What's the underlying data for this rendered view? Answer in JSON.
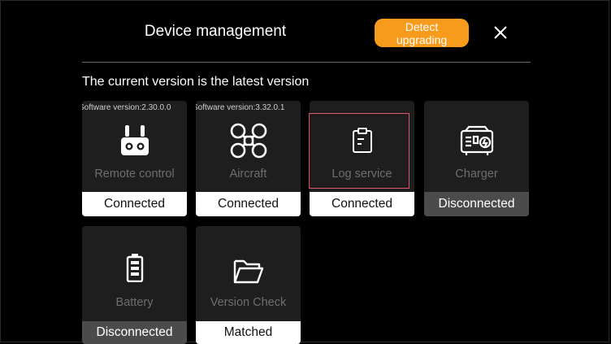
{
  "header": {
    "title": "Device management",
    "detect_label": "Detect upgrading",
    "close_icon": "close-icon"
  },
  "status_text": "The current version is the latest version",
  "devices": [
    {
      "key": "remote",
      "version": "Software version:2.30.0.0",
      "name": "Remote control",
      "state": "Connected",
      "icon": "remote-controller-icon"
    },
    {
      "key": "aircraft",
      "version": "Software version:3.32.0.1",
      "name": "Aircraft",
      "state": "Connected",
      "icon": "drone-icon"
    },
    {
      "key": "log",
      "version": "",
      "name": "Log service",
      "state": "Connected",
      "icon": "clipboard-icon"
    },
    {
      "key": "charger",
      "version": "",
      "name": "Charger",
      "state": "Disconnected",
      "icon": "charger-icon"
    },
    {
      "key": "battery",
      "version": "",
      "name": "Battery",
      "state": "Disconnected",
      "icon": "battery-icon"
    },
    {
      "key": "versioncheck",
      "version": "",
      "name": "Version Check",
      "state": "Matched",
      "icon": "folder-icon"
    }
  ],
  "colors": {
    "accent": "#f79b1c",
    "highlight": "#e0576c",
    "connected_bg": "#ffffff",
    "disconnected_bg": "#4b4b4b"
  }
}
